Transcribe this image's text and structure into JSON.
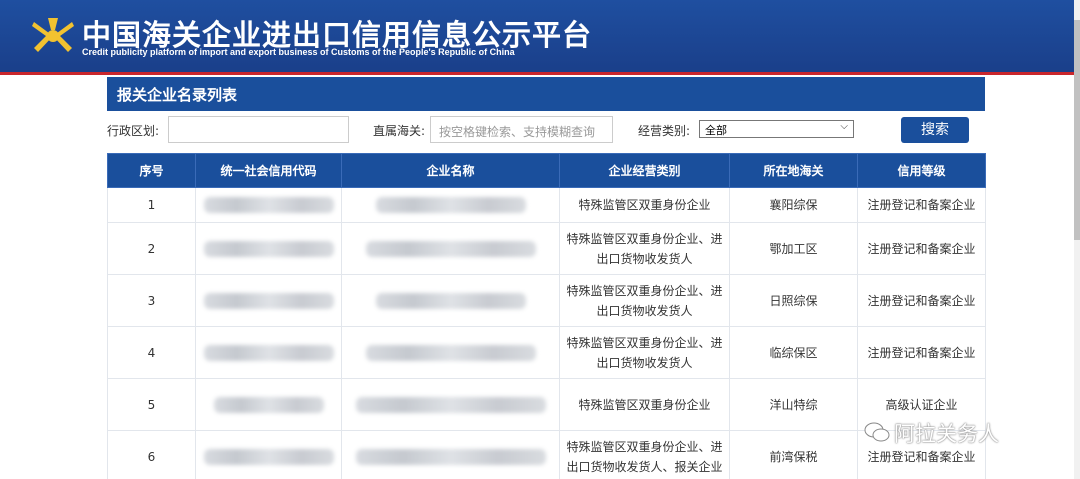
{
  "header": {
    "title": "中国海关企业进出口信用信息公示平台",
    "subtitle": "Credit publicity platform of import and export business of Customs of the People's Republic of China"
  },
  "section": {
    "title": "报关企业名录列表"
  },
  "filters": {
    "region_label": "行政区划:",
    "region_value": "",
    "customs_label": "直属海关:",
    "customs_placeholder": "按空格键检索、支持模糊查询",
    "business_label": "经营类别:",
    "business_value": "全部",
    "search_label": "搜索"
  },
  "table": {
    "columns": [
      "序号",
      "统一社会信用代码",
      "企业名称",
      "企业经营类别",
      "所在地海关",
      "信用等级"
    ],
    "rows": [
      {
        "index": "1",
        "category": "特殊监管区双重身份企业",
        "customs": "襄阳综保",
        "credit": "注册登记和备案企业"
      },
      {
        "index": "2",
        "category": "特殊监管区双重身份企业、进出口货物收发货人",
        "customs": "鄂加工区",
        "credit": "注册登记和备案企业"
      },
      {
        "index": "3",
        "category": "特殊监管区双重身份企业、进出口货物收发货人",
        "customs": "日照综保",
        "credit": "注册登记和备案企业"
      },
      {
        "index": "4",
        "category": "特殊监管区双重身份企业、进出口货物收发货人",
        "customs": "临综保区",
        "credit": "注册登记和备案企业"
      },
      {
        "index": "5",
        "category": "特殊监管区双重身份企业",
        "customs": "洋山特综",
        "credit": "高级认证企业"
      },
      {
        "index": "6",
        "category": "特殊监管区双重身份企业、进出口货物收发货人、报关企业",
        "customs": "前湾保税",
        "credit": "注册登记和备案企业"
      }
    ]
  },
  "watermark": {
    "text": "阿拉关务人"
  },
  "colors": {
    "brand_blue": "#1a4f9c",
    "banner_red": "#c9262c"
  }
}
